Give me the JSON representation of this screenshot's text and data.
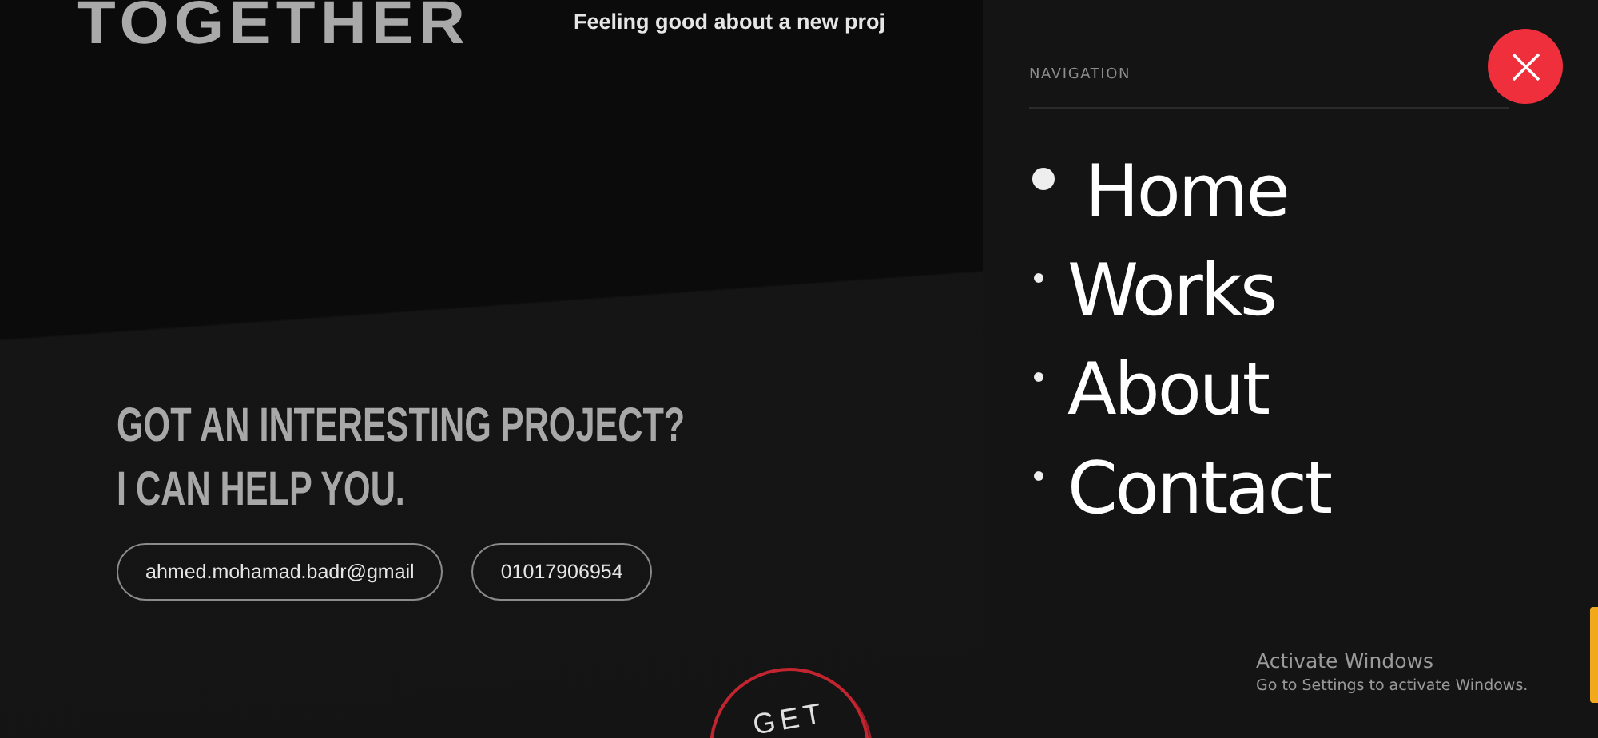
{
  "hero": {
    "title": "TOGETHER",
    "tagline": "Feeling good about a new proj"
  },
  "contact": {
    "heading_lines": [
      "GOT AN INTERESTING PROJECT?",
      "I CAN HELP YOU."
    ],
    "links": [
      {
        "label": "ahmed.mohamad.badr@gmail"
      },
      {
        "label": "01017906954"
      }
    ],
    "badge": "GET"
  },
  "navigation": {
    "title": "NAVIGATION",
    "items": [
      {
        "label": "Home",
        "selected": true
      },
      {
        "label": "Works",
        "selected": false
      },
      {
        "label": "About",
        "selected": false
      },
      {
        "label": "Contact",
        "selected": false
      }
    ]
  },
  "os_notice": {
    "title": "Activate Windows",
    "message": "Go to Settings to activate Windows."
  }
}
